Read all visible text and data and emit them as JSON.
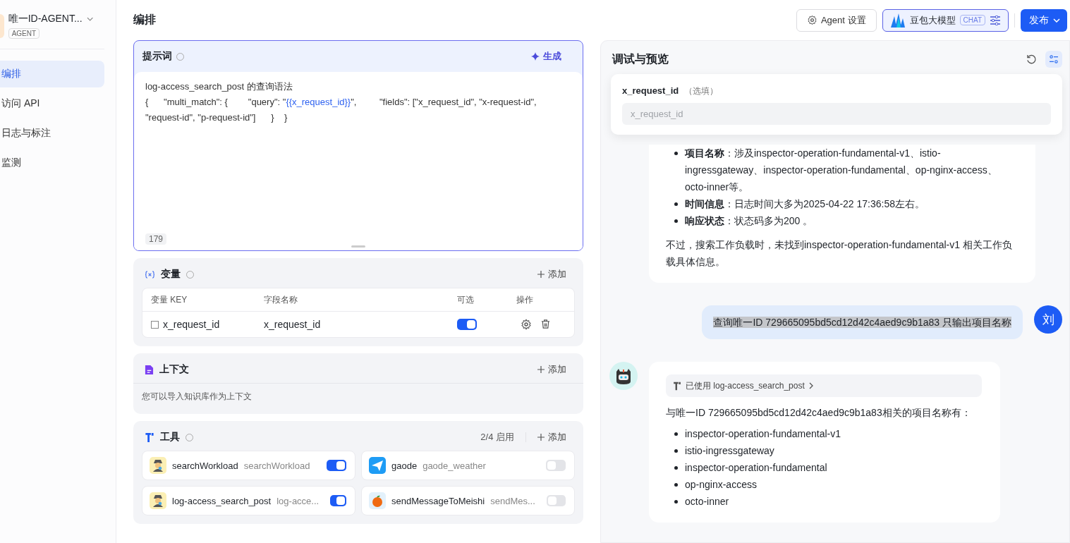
{
  "sidebar": {
    "agent_name": "唯一ID-AGENT...",
    "agent_tag": "AGENT",
    "items": [
      {
        "label": "编排",
        "selected": true
      },
      {
        "label": "访问 API",
        "selected": false
      },
      {
        "label": "日志与标注",
        "selected": false
      },
      {
        "label": "监测",
        "selected": false
      }
    ]
  },
  "header": {
    "title": "编排",
    "settings_button": "Agent 设置",
    "model_name": "豆包大模型",
    "model_tag": "CHAT",
    "publish_button": "发布"
  },
  "prompt": {
    "title": "提示词",
    "generate_button": "生成",
    "segments": [
      {
        "kind": "plain",
        "text": "log-access_search_post 的查询语法"
      },
      {
        "kind": "break"
      },
      {
        "kind": "plain",
        "text": "{      \"multi_match\": {        \"query\": \""
      },
      {
        "kind": "variable",
        "text": "{{x_request_id}}"
      },
      {
        "kind": "plain",
        "text": "\",         \"fields\": [\"x_request_id\", \"x-request-id\","
      },
      {
        "kind": "break"
      },
      {
        "kind": "plain",
        "text": "\"request-id\", \"p-request-id\"]      }    }"
      }
    ],
    "count": "179"
  },
  "variables": {
    "title": "变量",
    "add_button": "添加",
    "columns": [
      "变量 KEY",
      "字段名称",
      "可选",
      "操作"
    ],
    "rows": [
      {
        "key": "x_request_id",
        "field": "x_request_id",
        "optional": true
      }
    ]
  },
  "context": {
    "title": "上下文",
    "add_button": "添加",
    "hint": "您可以导入知识库作为上下文"
  },
  "tools": {
    "title": "工具",
    "enabled_count": "2/4 启用",
    "add_button": "添加",
    "items": [
      {
        "name": "searchWorkload",
        "id": "searchWorkload",
        "on": true,
        "kind": "agent"
      },
      {
        "name": "gaode",
        "id": "gaode_weather",
        "on": false,
        "kind": "plane"
      },
      {
        "name": "log-access_search_post",
        "id": "log-acce...",
        "on": true,
        "kind": "agent"
      },
      {
        "name": "sendMessageToMeishi",
        "id": "sendMes...",
        "on": false,
        "kind": "orange"
      }
    ]
  },
  "preview": {
    "title": "调试与预览",
    "variable_popover": {
      "label": "x_request_id",
      "note": "（选填）",
      "placeholder": "x_request_id"
    },
    "messages": [
      {
        "kind": "bot_continued",
        "bullets": [
          "**项目名称**：涉及inspector-operation-fundamental-v1、istio-ingressgateway、inspector-operation-fundamental、op-nginx-access、octo-inner等。",
          "**时间信息**：日志时间大多为2025-04-22 17:36:58左右。",
          "**响应状态**：状态码多为200 。"
        ],
        "after": "不过，搜索工作负载时，未找到inspector-operation-fundamental-v1 相关工作负载具体信息。"
      },
      {
        "kind": "user",
        "avatar_text": "刘",
        "text": "查询唯一ID 729665095bd5cd12d42c4aed9c9b1a83 只输出项目名称"
      },
      {
        "kind": "bot",
        "tool_used": "已使用 log-access_search_post",
        "before": "与唯一ID 729665095bd5cd12d42c4aed9c9b1a83相关的项目名称有：",
        "bullets": [
          "inspector-operation-fundamental-v1",
          "istio-ingressgateway",
          "inspector-operation-fundamental",
          "op-nginx-access",
          "octo-inner"
        ]
      }
    ]
  }
}
